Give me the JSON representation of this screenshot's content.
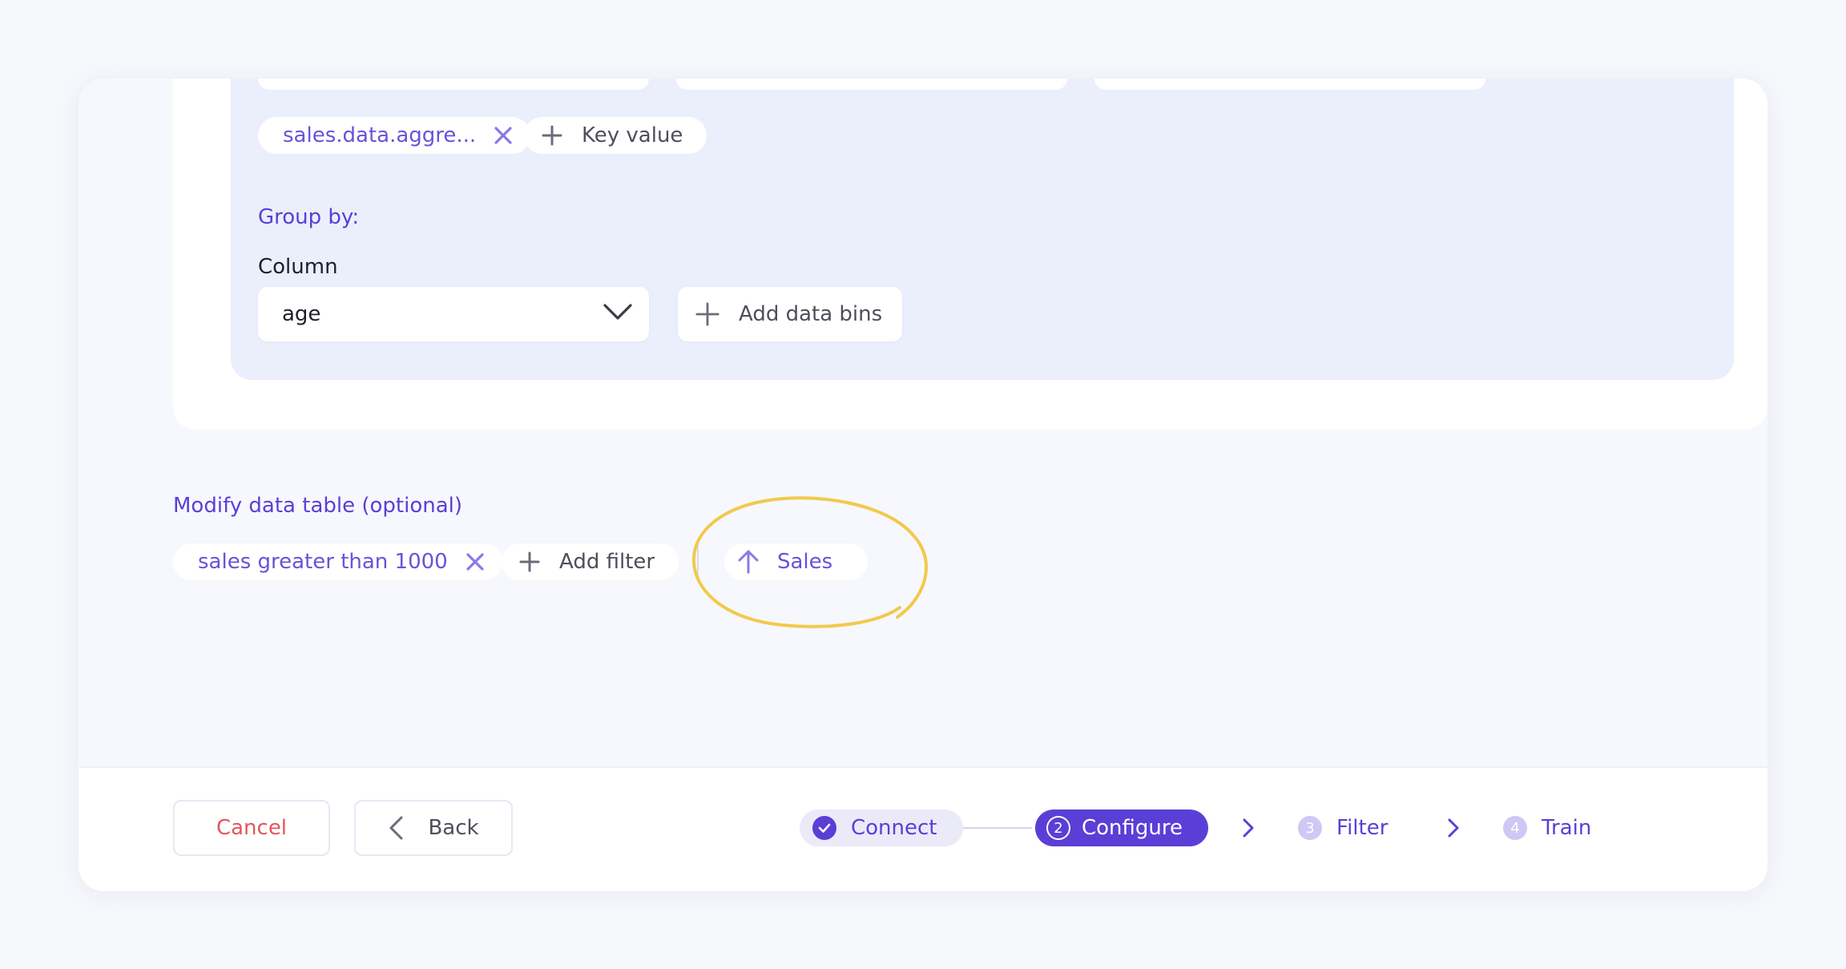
{
  "aggregate": {
    "key_tag": "sales.data.aggre...",
    "key_value_label": "Key value",
    "group_by_label": "Group by:",
    "column_label": "Column",
    "column_value": "age",
    "add_bins_label": "Add data bins"
  },
  "modify": {
    "title": "Modify data table (optional)",
    "filter_tag": "sales greater than 1000",
    "add_filter_label": "Add filter",
    "sort_label": "Sales"
  },
  "footer": {
    "cancel_label": "Cancel",
    "back_label": "Back"
  },
  "stepper": {
    "steps": [
      {
        "label": "Connect",
        "state": "done"
      },
      {
        "number": "2",
        "label": "Configure",
        "state": "active"
      },
      {
        "number": "3",
        "label": "Filter",
        "state": "pending"
      },
      {
        "number": "4",
        "label": "Train",
        "state": "pending"
      }
    ]
  },
  "colors": {
    "accent": "#5a3fd6",
    "cancel": "#e0575c",
    "highlight": "#f2c94c"
  }
}
